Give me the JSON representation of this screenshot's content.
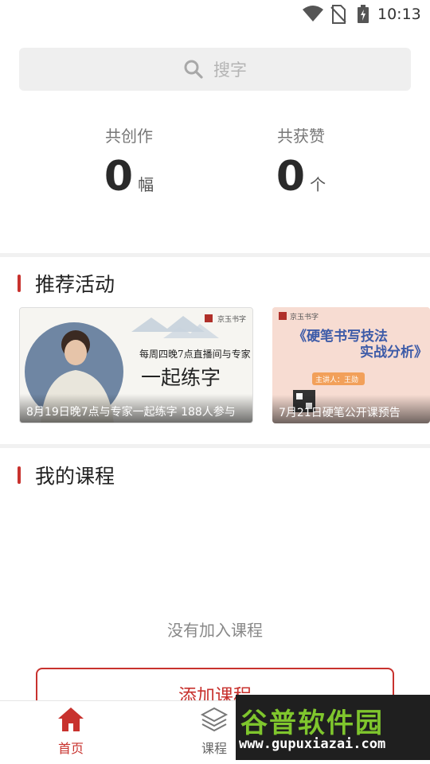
{
  "status_bar": {
    "time": "10:13"
  },
  "search": {
    "placeholder": "搜字"
  },
  "stats": {
    "creations_label": "共创作",
    "creations_value": "0",
    "creations_unit": "幅",
    "likes_label": "共获赞",
    "likes_value": "0",
    "likes_unit": "个"
  },
  "activities": {
    "title": "推荐活动",
    "cards": [
      {
        "caption": "8月19日晚7点与专家一起练字   188人参与",
        "brand": "京玉书字",
        "line1": "每周四晚7点直播间与专家",
        "line2": "一起练字"
      },
      {
        "caption": "7月21日硬笔公开课预告",
        "brand": "京玉书字",
        "line1": "《硬笔书写技法",
        "line2": "实战分析》",
        "badge": "主讲人：王勋"
      }
    ]
  },
  "my_courses": {
    "title": "我的课程",
    "empty_text": "没有加入课程",
    "add_button": "添加课程"
  },
  "bottom_nav": {
    "items": [
      {
        "label": "首页",
        "active": true
      },
      {
        "label": "课程",
        "active": false
      }
    ]
  },
  "watermark": {
    "title": "谷普软件园",
    "url": "www.gupuxiazai.com"
  },
  "colors": {
    "accent": "#c8322e",
    "watermark_green": "#7fc62d"
  }
}
